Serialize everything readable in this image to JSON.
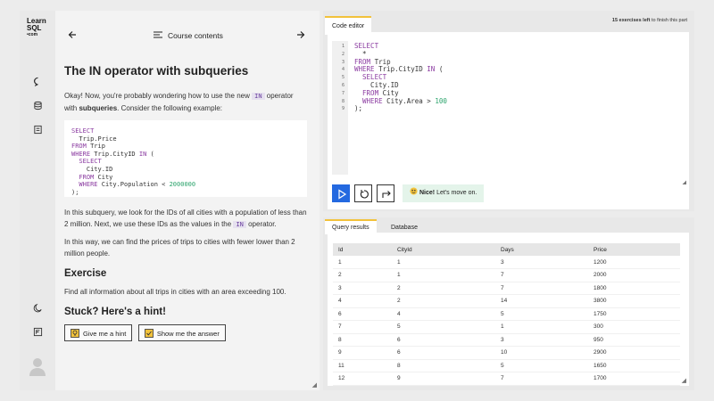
{
  "brand": {
    "line1": "Learn",
    "line2": "SQL",
    "line3": "•com"
  },
  "nav": {
    "title": "Course contents"
  },
  "lesson": {
    "title": "The IN operator with subqueries",
    "intro_a": "Okay! Now, you're probably wondering how to use the new",
    "intro_kw": "IN",
    "intro_b": "operator",
    "intro_c": "with",
    "intro_bold": "subqueries",
    "intro_d": ". Consider the following example:",
    "example_code": [
      {
        "kw": "SELECT",
        "rest": ""
      },
      {
        "kw": "",
        "rest": "  Trip.Price"
      },
      {
        "kw": "FROM",
        "rest": " Trip"
      },
      {
        "kw": "WHERE",
        "rest": " Trip.CityID ",
        "kw2": "IN",
        "rest2": " ("
      },
      {
        "kw": "  SELECT",
        "rest": ""
      },
      {
        "kw": "",
        "rest": "    City.ID"
      },
      {
        "kw": "  FROM",
        "rest": " City"
      },
      {
        "kw": "  WHERE",
        "rest": " City.Population < ",
        "num": "2000000"
      },
      {
        "kw": "",
        "rest": ");"
      }
    ],
    "para2_a": "In this subquery, we look for the IDs of all cities with a population of less than 2 million. Next, we use these IDs as the values in the",
    "para2_kw": "IN",
    "para2_b": "operator.",
    "para3": "In this way, we can find the prices of trips to cities with fewer lower than 2 million people.",
    "exercise_heading": "Exercise",
    "exercise_text": "Find all information about all trips in cities with an area exceeding 100.",
    "hint_heading": "Stuck? Here's a hint!",
    "hint_button": "Give me a hint",
    "answer_button": "Show me the answer"
  },
  "editor": {
    "tab_label": "Code editor",
    "exercises_left_count": "15 exercises left",
    "exercises_left_suffix": " to finish this part",
    "line_numbers": [
      "1",
      "2",
      "3",
      "4",
      "5",
      "6",
      "7",
      "8",
      "9"
    ],
    "lines": [
      {
        "kw": "SELECT",
        "rest": ""
      },
      {
        "kw": "",
        "rest": "  *"
      },
      {
        "kw": "FROM",
        "rest": " Trip"
      },
      {
        "kw": "WHERE",
        "rest": " Trip.CityID ",
        "kw2": "IN",
        "rest2": " ("
      },
      {
        "kw": "  SELECT",
        "rest": ""
      },
      {
        "kw": "",
        "rest": "    City.ID"
      },
      {
        "kw": "  FROM",
        "rest": " City"
      },
      {
        "kw": "  WHERE",
        "rest": " City.Area > ",
        "num": "100"
      },
      {
        "kw": "",
        "rest": ");"
      }
    ],
    "nice_bold": "Nice!",
    "nice_rest": " Let's move on."
  },
  "results": {
    "tabs": [
      "Query results",
      "Database"
    ],
    "columns": [
      "Id",
      "CityId",
      "Days",
      "Price"
    ],
    "rows": [
      [
        "1",
        "1",
        "3",
        "1200"
      ],
      [
        "2",
        "1",
        "7",
        "2000"
      ],
      [
        "3",
        "2",
        "7",
        "1800"
      ],
      [
        "4",
        "2",
        "14",
        "3800"
      ],
      [
        "6",
        "4",
        "5",
        "1750"
      ],
      [
        "7",
        "5",
        "1",
        "300"
      ],
      [
        "8",
        "6",
        "3",
        "950"
      ],
      [
        "9",
        "6",
        "10",
        "2900"
      ],
      [
        "11",
        "8",
        "5",
        "1650"
      ],
      [
        "12",
        "9",
        "7",
        "1700"
      ]
    ]
  },
  "colors": {
    "accent": "#f2c23b",
    "run": "#2469e0",
    "keyword": "#8a3aa0",
    "number": "#2aa36b",
    "success_bg": "#e4f4ea"
  }
}
